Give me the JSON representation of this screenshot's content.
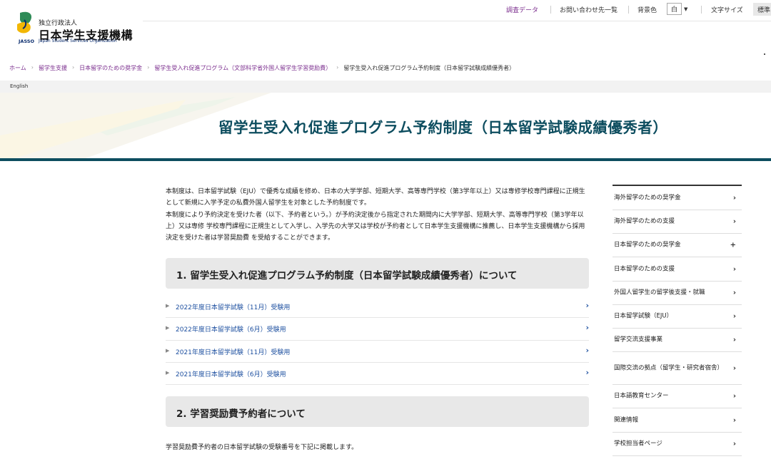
{
  "header": {
    "org_label": "独立行政法人",
    "org_name": "日本学生支援機構",
    "logo_abbrev": "JASSO",
    "org_name_en": "Japan Student Services Organization",
    "utility": {
      "research": "調査データ",
      "contact": "お問い合わせ先一覧",
      "bg_label": "背景色",
      "bg_value": "白",
      "font_label": "文字サイズ",
      "font_value": "標準"
    }
  },
  "breadcrumb": {
    "items": [
      "ホーム",
      "留学生支援",
      "日本留学のための奨学金",
      "留学生受入れ促進プログラム（文部科学省外国人留学生学習奨励費）"
    ],
    "current": "留学生受入れ促進プログラム予約制度（日本留学試験成績優秀者）"
  },
  "lang": {
    "english": "English"
  },
  "page": {
    "title": "留学生受入れ促進プログラム予約制度（日本留学試験成績優秀者）",
    "intro": [
      "本制度は、日本留学試験（EJU）で優秀な成績を修め、日本の大学学部、短期大学、高等専門学校（第3学年以上）又は専修学校専門課程に正規生として新規に入学予定の私費外国人留学生を対象とした予約制度です。",
      "本制度により予約決定を受けた者（以下、予約者という。）が予約決定後から指定された期間内に大学学部、短期大学、高等専門学校（第3学年以上）又は専修 学校専門課程に正規生として入学し、入学先の大学又は学校が予約者として日本学生支援機構に推薦し、日本学生支援機構から採用決定を受けた者は学習奨励費 を受給することができます。"
    ],
    "section1": {
      "heading": "1. 留学生受入れ促進プログラム予約制度（日本留学試験成績優秀者）について",
      "links": [
        "2022年度日本留学試験（11月）受験用",
        "2022年度日本留学試験（6月）受験用",
        "2021年度日本留学試験（11月）受験用",
        "2021年度日本留学試験（6月）受験用"
      ]
    },
    "section2": {
      "heading": "2. 学習奨励費予約者について",
      "text": "学習奨励費予約者の日本留学試験の受験番号を下記に掲載します。"
    }
  },
  "sidebar": {
    "items": [
      {
        "label": "海外留学のための奨学金",
        "icon": "›"
      },
      {
        "label": "海外留学のための支援",
        "icon": "›"
      },
      {
        "label": "日本留学のための奨学金",
        "icon": "+"
      },
      {
        "label": "日本留学のための支援",
        "icon": "›"
      },
      {
        "label": "外国人留学生の留学後支援・就職",
        "icon": "›"
      },
      {
        "label": "日本留学試験（EJU）",
        "icon": "›"
      },
      {
        "label": "留学交流支援事業",
        "icon": "›"
      },
      {
        "label": "国際交流の拠点（留学生・研究者宿舎）",
        "icon": "›"
      },
      {
        "label": "日本語教育センター",
        "icon": "›"
      },
      {
        "label": "関連情報",
        "icon": "›"
      },
      {
        "label": "学校担当者ページ",
        "icon": "›"
      }
    ]
  },
  "colors": {
    "accent": "#0d4d5f",
    "link": "#1e50a0",
    "breadcrumb": "#7b2e8e",
    "logo_yellow": "#f2b705",
    "logo_green": "#2e8b57"
  }
}
